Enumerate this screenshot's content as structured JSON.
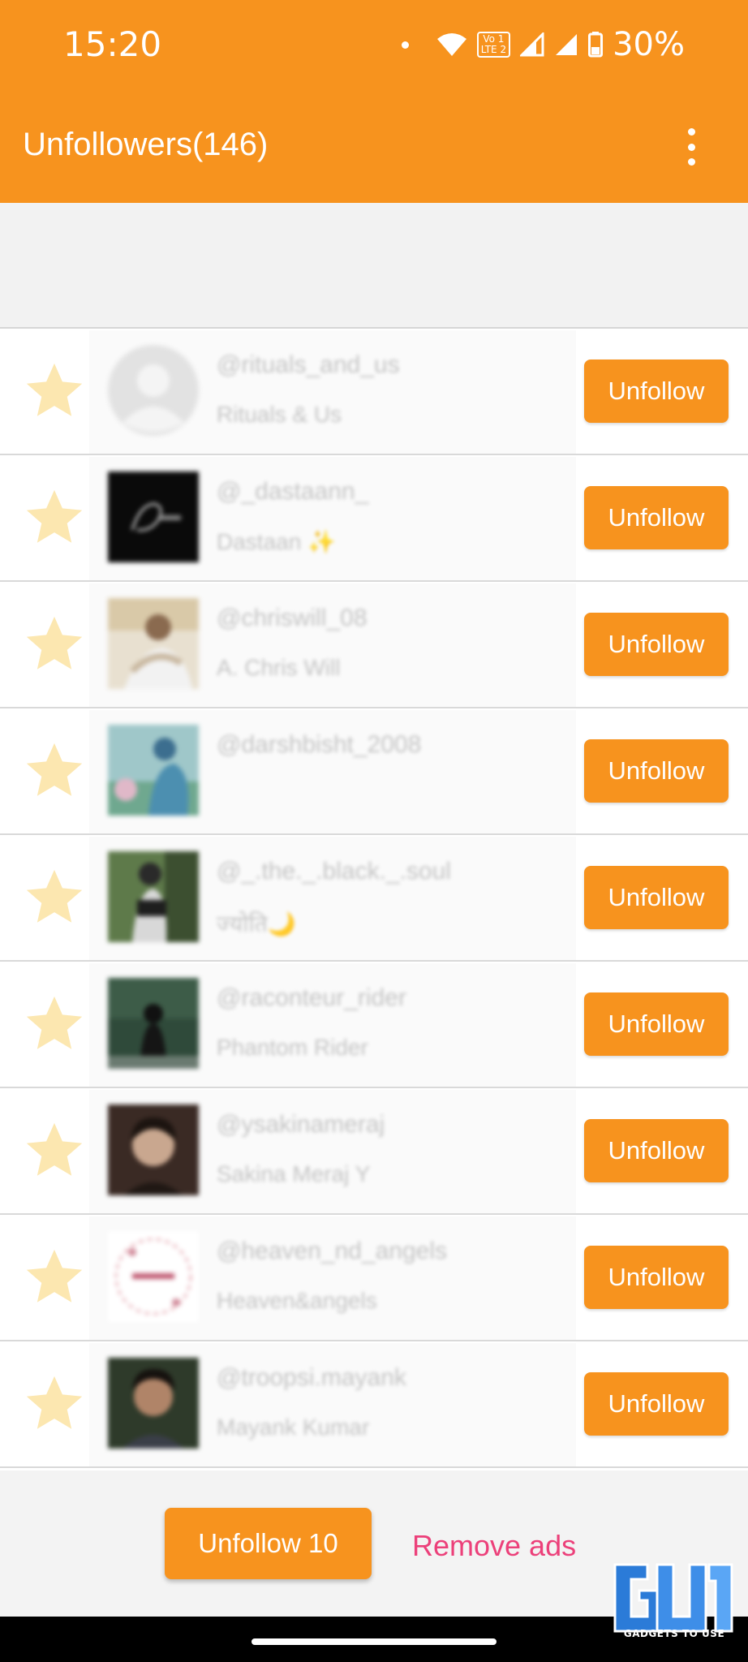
{
  "status_bar": {
    "time": "15:20",
    "sim_badge_line1": "Vo 1",
    "sim_badge_line2": "LTE 2",
    "battery": "30%"
  },
  "app_bar": {
    "title": "Unfollowers(146)",
    "menu_icon": "more-vert-icon"
  },
  "colors": {
    "accent": "#F7931E",
    "star": "#FCE7B0",
    "link": "#EC407A"
  },
  "users": [
    {
      "handle": "@rituals_and_us",
      "name": "Rituals & Us",
      "button": "Unfollow"
    },
    {
      "handle": "@_dastaann_",
      "name": "Dastaan ✨",
      "button": "Unfollow"
    },
    {
      "handle": "@chriswill_08",
      "name": "A. Chris Will",
      "button": "Unfollow"
    },
    {
      "handle": "@darshbisht_2008",
      "name": "",
      "button": "Unfollow"
    },
    {
      "handle": "@_.the._.black._.soul",
      "name": "ज्योति🌙",
      "button": "Unfollow"
    },
    {
      "handle": "@raconteur_rider",
      "name": "Phantom Rider",
      "button": "Unfollow"
    },
    {
      "handle": "@ysakinameraj",
      "name": "Sakina Meraj Y",
      "button": "Unfollow"
    },
    {
      "handle": "@heaven_nd_angels",
      "name": "Heaven&angels",
      "button": "Unfollow"
    },
    {
      "handle": "@troopsi.mayank",
      "name": "Mayank Kumar",
      "button": "Unfollow"
    }
  ],
  "footer": {
    "bulk_button": "Unfollow 10",
    "remove_ads": "Remove ads"
  },
  "watermark": {
    "text": "GADGETS TO USE"
  }
}
